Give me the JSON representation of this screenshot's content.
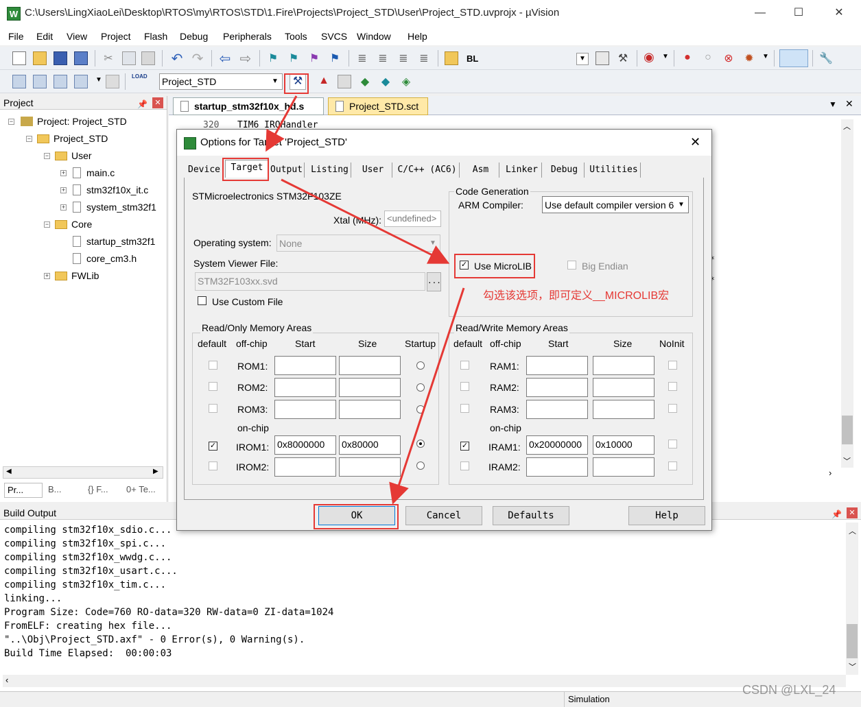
{
  "window": {
    "icon_text": "W",
    "title": "C:\\Users\\LingXiaoLei\\Desktop\\RTOS\\my\\RTOS\\STD\\1.Fire\\Projects\\Project_STD\\User\\Project_STD.uvprojx - µVision"
  },
  "menu": [
    "File",
    "Edit",
    "View",
    "Project",
    "Flash",
    "Debug",
    "Peripherals",
    "Tools",
    "SVCS",
    "Window",
    "Help"
  ],
  "toolbar1": {
    "bl_label": "BL"
  },
  "toolbar2": {
    "load_label": "LOAD",
    "target_value": "Project_STD"
  },
  "project_panel": {
    "header": "Project",
    "tree": [
      {
        "label": "Project: Project_STD",
        "kind": "root"
      },
      {
        "label": "Project_STD",
        "kind": "folder"
      },
      {
        "label": "User",
        "kind": "folder"
      },
      {
        "label": "main.c",
        "kind": "file"
      },
      {
        "label": "stm32f10x_it.c",
        "kind": "file"
      },
      {
        "label": "system_stm32f1",
        "kind": "file"
      },
      {
        "label": "Core",
        "kind": "folder"
      },
      {
        "label": "startup_stm32f1",
        "kind": "file"
      },
      {
        "label": "core_cm3.h",
        "kind": "file"
      },
      {
        "label": "FWLib",
        "kind": "folder"
      }
    ],
    "bottom_tabs": [
      "Pr...",
      "B...",
      "{} F...",
      "0+ Te..."
    ]
  },
  "editor": {
    "tabs": [
      "startup_stm32f10x_hd.s",
      "Project_STD.sct"
    ],
    "line_no": "320",
    "code": "TIM6_IRQHandler",
    "star_mark": "*"
  },
  "dialog": {
    "title": "Options for Target 'Project_STD'",
    "tabs": [
      "Device",
      "Target",
      "Output",
      "Listing",
      "User",
      "C/C++ (AC6)",
      "Asm",
      "Linker",
      "Debug",
      "Utilities"
    ],
    "active_tab": "Target",
    "device": "STMicroelectronics STM32F103ZE",
    "xtal_label": "Xtal (MHz):",
    "xtal_value": "<undefined>",
    "os_label": "Operating system:",
    "os_value": "None",
    "svd_label": "System Viewer File:",
    "svd_value": "STM32F103xx.svd",
    "svd_browse": "...",
    "use_custom_file": "Use Custom File",
    "code_gen_label": "Code Generation",
    "arm_compiler_label": "ARM Compiler:",
    "arm_compiler_value": "Use default compiler version 6",
    "use_microlib": "Use MicroLIB",
    "use_microlib_checked": true,
    "big_endian": "Big Endian",
    "ro_label": "Read/Only Memory Areas",
    "rw_label": "Read/Write Memory Areas",
    "ro_headers": [
      "default",
      "off-chip",
      "Start",
      "Size",
      "Startup"
    ],
    "rw_headers": [
      "default",
      "off-chip",
      "Start",
      "Size",
      "NoInit"
    ],
    "on_chip": "on-chip",
    "ro_rows": [
      {
        "name": "ROM1:",
        "start": "",
        "size": "",
        "default": false,
        "startup": false
      },
      {
        "name": "ROM2:",
        "start": "",
        "size": "",
        "default": false,
        "startup": false
      },
      {
        "name": "ROM3:",
        "start": "",
        "size": "",
        "default": false,
        "startup": false
      },
      {
        "name": "IROM1:",
        "start": "0x8000000",
        "size": "0x80000",
        "default": true,
        "startup": true
      },
      {
        "name": "IROM2:",
        "start": "",
        "size": "",
        "default": false,
        "startup": false
      }
    ],
    "rw_rows": [
      {
        "name": "RAM1:",
        "start": "",
        "size": "",
        "default": false,
        "noinit": false
      },
      {
        "name": "RAM2:",
        "start": "",
        "size": "",
        "default": false,
        "noinit": false
      },
      {
        "name": "RAM3:",
        "start": "",
        "size": "",
        "default": false,
        "noinit": false
      },
      {
        "name": "IRAM1:",
        "start": "0x20000000",
        "size": "0x10000",
        "default": true,
        "noinit": false
      },
      {
        "name": "IRAM2:",
        "start": "",
        "size": "",
        "default": false,
        "noinit": false
      }
    ],
    "buttons": {
      "ok": "OK",
      "cancel": "Cancel",
      "defaults": "Defaults",
      "help": "Help"
    }
  },
  "annotation": "勾选该选项，即可定义__MICROLIB宏",
  "build_output": {
    "header": "Build Output",
    "lines": [
      "compiling stm32f10x_sdio.c...",
      "compiling stm32f10x_spi.c...",
      "compiling stm32f10x_wwdg.c...",
      "compiling stm32f10x_usart.c...",
      "compiling stm32f10x_tim.c...",
      "linking...",
      "Program Size: Code=760 RO-data=320 RW-data=0 ZI-data=1024",
      "FromELF: creating hex file...",
      "\"..\\Obj\\Project_STD.axf\" - 0 Error(s), 0 Warning(s).",
      "Build Time Elapsed:  00:00:03"
    ]
  },
  "status": {
    "mode": "Simulation"
  },
  "watermark": "CSDN @LXL_24",
  "colors": {
    "annotation_red": "#e53935",
    "app_green": "#2e8b3a"
  }
}
